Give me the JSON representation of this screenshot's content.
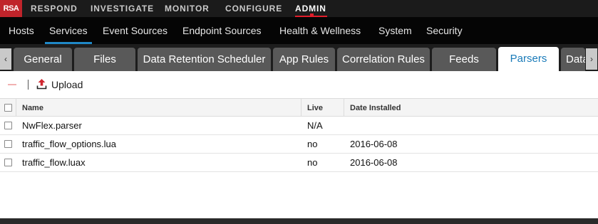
{
  "brand": {
    "logo": "RSA"
  },
  "top_nav": {
    "items": [
      {
        "label": "RESPOND"
      },
      {
        "label": "INVESTIGATE"
      },
      {
        "label": "MONITOR"
      },
      {
        "label": "CONFIGURE"
      },
      {
        "label": "ADMIN",
        "active": true
      }
    ]
  },
  "sub_nav": {
    "items": [
      {
        "label": "Hosts"
      },
      {
        "label": "Services",
        "active": true
      },
      {
        "label": "Event Sources"
      },
      {
        "label": "Endpoint Sources"
      },
      {
        "label": "Health & Wellness"
      },
      {
        "label": "System"
      },
      {
        "label": "Security"
      }
    ]
  },
  "tabs": {
    "scroll_left": "‹",
    "scroll_right": "›",
    "items": [
      {
        "label": "General"
      },
      {
        "label": "Files"
      },
      {
        "label": "Data Retention Scheduler"
      },
      {
        "label": "App Rules"
      },
      {
        "label": "Correlation Rules"
      },
      {
        "label": "Feeds"
      },
      {
        "label": "Parsers",
        "active": true
      },
      {
        "label": "Data"
      }
    ]
  },
  "toolbar": {
    "remove_icon": "minus-icon",
    "upload_icon": "upload-icon",
    "upload_label": "Upload"
  },
  "table": {
    "columns": [
      "Name",
      "Live",
      "Date Installed"
    ],
    "rows": [
      {
        "name": "NwFlex.parser",
        "live": "N/A",
        "date_installed": ""
      },
      {
        "name": "traffic_flow_options.lua",
        "live": "no",
        "date_installed": "2016-06-08"
      },
      {
        "name": "traffic_flow.luax",
        "live": "no",
        "date_installed": "2016-06-08"
      }
    ]
  },
  "colors": {
    "brand_red": "#c0242b",
    "active_accent_red": "#e01e2b",
    "active_tab_blue": "#1a7bb9",
    "subnav_underline_blue": "#1f88c7"
  }
}
